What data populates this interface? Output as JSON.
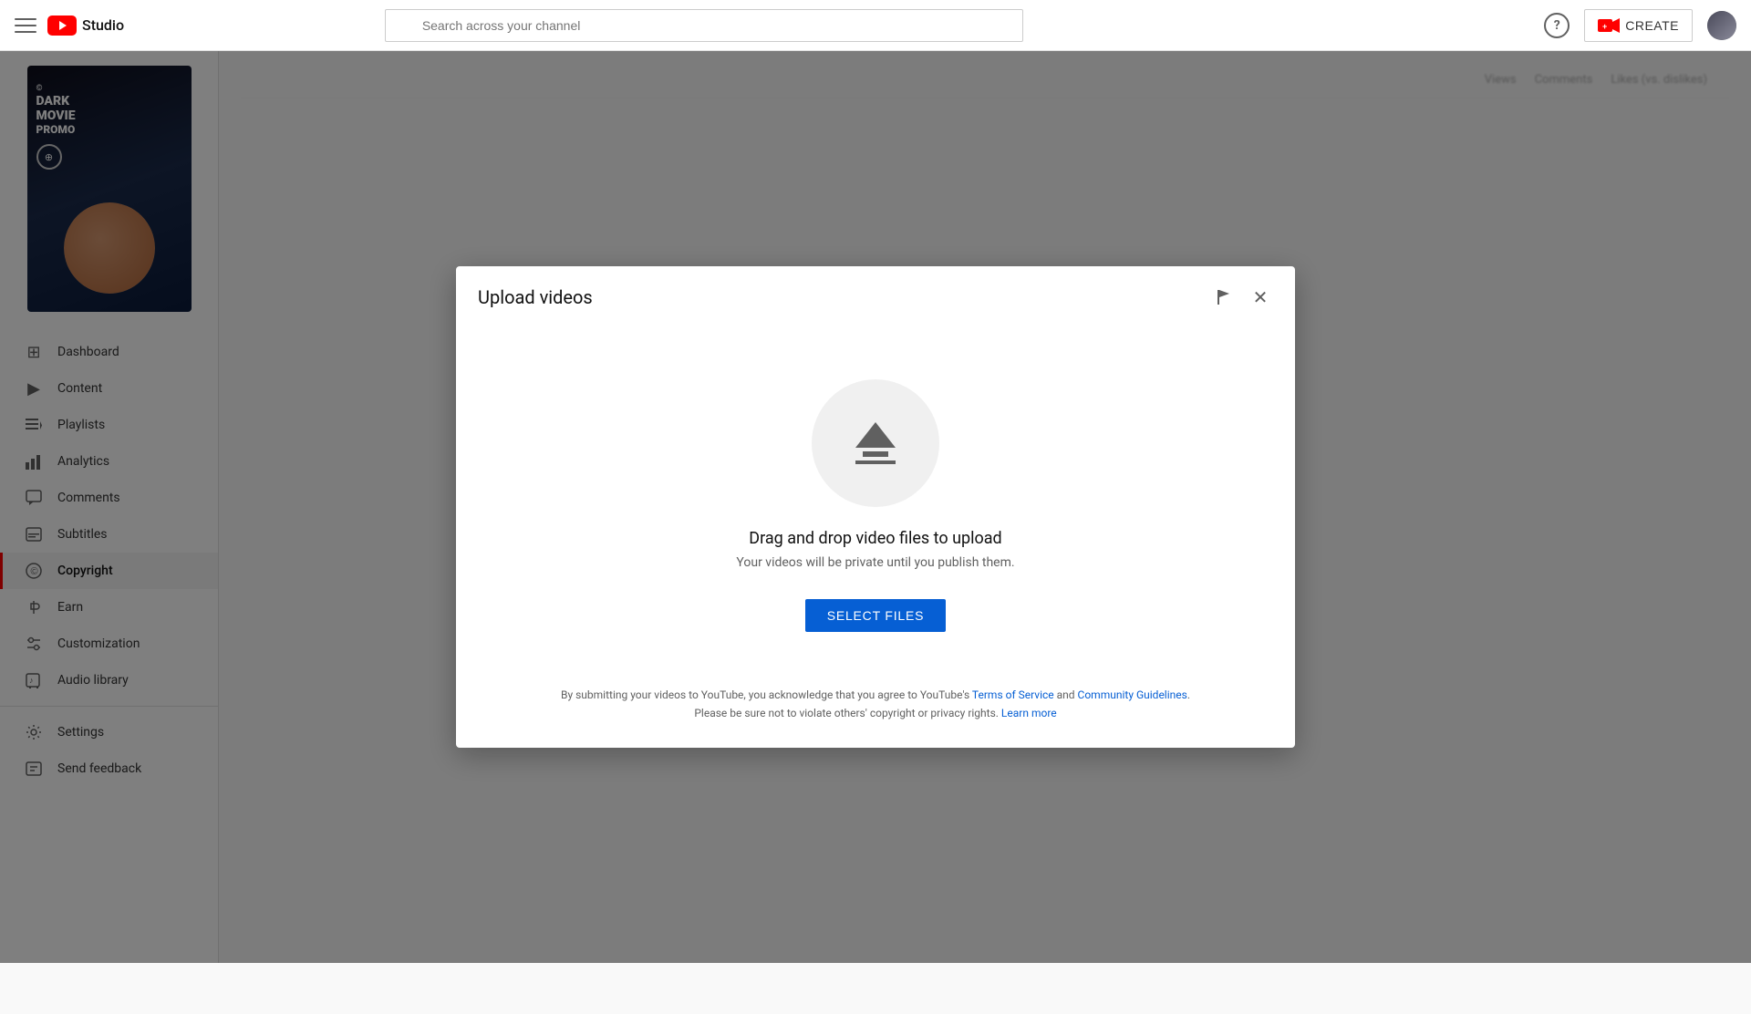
{
  "header": {
    "menu_icon": "☰",
    "logo_text": "Studio",
    "search_placeholder": "Search across your channel",
    "help_icon": "?",
    "create_label": "CREATE",
    "avatar_alt": "user-avatar"
  },
  "sidebar": {
    "channel_name": "Dark Movie Promo",
    "nav_items": [
      {
        "id": "dashboard",
        "label": "Dashboard",
        "icon": "⊞",
        "active": false
      },
      {
        "id": "content",
        "label": "Content",
        "icon": "▶",
        "active": false
      },
      {
        "id": "playlists",
        "label": "Playlists",
        "icon": "☰",
        "active": false
      },
      {
        "id": "analytics",
        "label": "Analytics",
        "icon": "📊",
        "active": false
      },
      {
        "id": "comments",
        "label": "Comments",
        "icon": "💬",
        "active": false
      },
      {
        "id": "subtitles",
        "label": "Subtitles",
        "icon": "⊟",
        "active": false
      },
      {
        "id": "copyright",
        "label": "Copyright",
        "icon": "©",
        "active": false
      },
      {
        "id": "earn",
        "label": "Earn",
        "icon": "$",
        "active": false
      },
      {
        "id": "customization",
        "label": "Customization",
        "icon": "✏",
        "active": false
      },
      {
        "id": "audio_library",
        "label": "Audio library",
        "icon": "♪",
        "active": false
      }
    ],
    "bottom_items": [
      {
        "id": "settings",
        "label": "Settings",
        "icon": "⚙"
      },
      {
        "id": "send_feedback",
        "label": "Send feedback",
        "icon": "!"
      }
    ]
  },
  "modal": {
    "title": "Upload videos",
    "flag_icon": "🚩",
    "close_icon": "✕",
    "drag_drop_title": "Drag and drop video files to upload",
    "drag_drop_subtitle": "Your videos will be private until you publish them.",
    "select_files_label": "SELECT FILES",
    "footer_text_before": "By submitting your videos to YouTube, you acknowledge that you agree to YouTube's ",
    "terms_label": "Terms of Service",
    "footer_and": " and ",
    "guidelines_label": "Community Guidelines",
    "footer_text_after": ".\nPlease be sure not to violate others' copyright or privacy rights. ",
    "learn_more_label": "Learn more"
  },
  "background": {
    "table_headers": [
      "Views",
      "Comments",
      "Likes (vs. dislikes)"
    ]
  }
}
